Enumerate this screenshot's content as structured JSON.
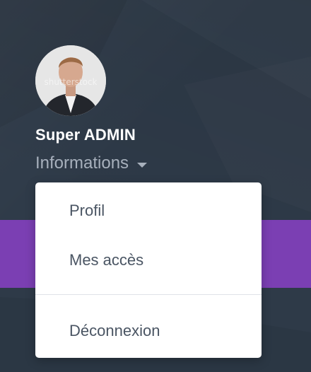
{
  "user": {
    "name": "Super ADMIN",
    "avatar_icon": "user-photo",
    "avatar_watermark": "shutterstock"
  },
  "info_menu": {
    "label": "Informations",
    "caret_icon": "caret-down-icon"
  },
  "dropdown": {
    "items": [
      {
        "label": "Profil"
      },
      {
        "label": "Mes accès"
      },
      {
        "label": "Déconnexion"
      }
    ]
  },
  "colors": {
    "sidebar_bg": "#2e3a48",
    "accent_band": "#7b3fb3",
    "name_text": "#ffffff",
    "muted_text": "#a7b0bc",
    "menu_text": "#4a5563"
  }
}
